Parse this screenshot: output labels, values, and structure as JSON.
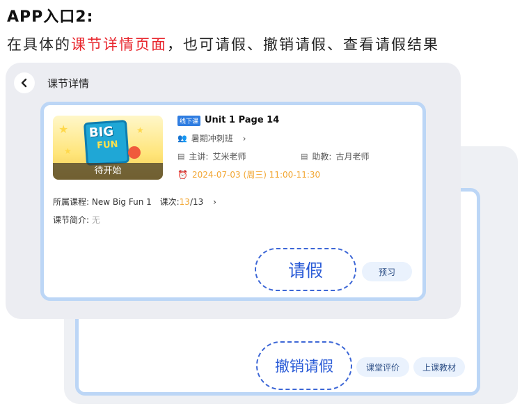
{
  "page": {
    "heading": "APP入口2:",
    "sub_prefix": "在具体的",
    "sub_highlight": "课节详情页面",
    "sub_suffix": "，也可请假、撤销请假、查看请假结果"
  },
  "nav": {
    "title": "课节详情"
  },
  "lesson": {
    "cover_status": "待开始",
    "cover_book_text_1": "BIG",
    "cover_book_text_2": "FUN",
    "tag": "线下课",
    "title": "Unit 1 Page 14",
    "class_name": "暑期冲刺班",
    "teacher_label": "主讲:",
    "teacher": "艾米老师",
    "assistant_label": "助教:",
    "assistant": "古月老师",
    "time": "2024-07-03 (周三) 11:00-11:30",
    "course_label": "所属课程:",
    "course": "New Big Fun 1",
    "session_label": "课次:",
    "session_current": "13",
    "session_total": "/13",
    "intro_label": "课节简介:",
    "intro": "无"
  },
  "actions": {
    "leave": "请假",
    "preview": "预习",
    "cancel_leave": "撤销请假",
    "evaluation": "课堂评价",
    "materials": "上课教材"
  },
  "colors": {
    "accent": "#2a5bd7",
    "highlight": "#e8262d",
    "time": "#f2a530"
  }
}
